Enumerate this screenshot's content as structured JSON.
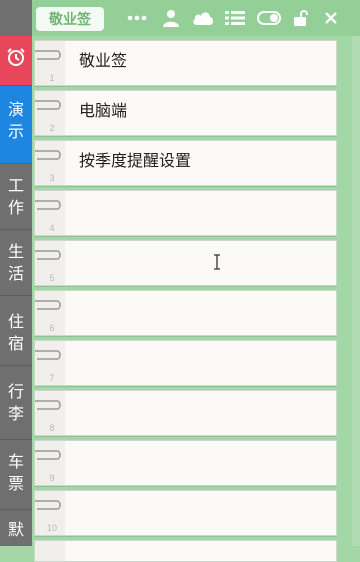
{
  "header": {
    "title": "敬业签",
    "icons": [
      "more-dots-icon",
      "user-icon",
      "cloud-icon",
      "list-icon",
      "toggle-icon",
      "unlock-icon",
      "close-icon"
    ]
  },
  "sidebar": {
    "alarm_icon": "alarm-clock-icon",
    "tabs": [
      {
        "label_1": "演",
        "label_2": "示"
      },
      {
        "label_1": "工",
        "label_2": "作"
      },
      {
        "label_1": "生",
        "label_2": "活"
      },
      {
        "label_1": "住",
        "label_2": "宿"
      },
      {
        "label_1": "行",
        "label_2": "李"
      },
      {
        "label_1": "车",
        "label_2": "票"
      },
      {
        "label_1": "默",
        "label_2": ""
      }
    ]
  },
  "notes": [
    {
      "index": "1",
      "text": "敬业签"
    },
    {
      "index": "2",
      "text": "电脑端"
    },
    {
      "index": "3",
      "text": "按季度提醒设置"
    },
    {
      "index": "4",
      "text": ""
    },
    {
      "index": "5",
      "text": ""
    },
    {
      "index": "6",
      "text": ""
    },
    {
      "index": "7",
      "text": ""
    },
    {
      "index": "8",
      "text": ""
    },
    {
      "index": "9",
      "text": ""
    },
    {
      "index": "10",
      "text": ""
    }
  ],
  "colors": {
    "header_bg": "#94cf97",
    "accent_green": "#6fb573",
    "alarm_tab": "#e8465a",
    "active_tab": "#1c86e0",
    "rail_bg": "#6f6f6f"
  }
}
